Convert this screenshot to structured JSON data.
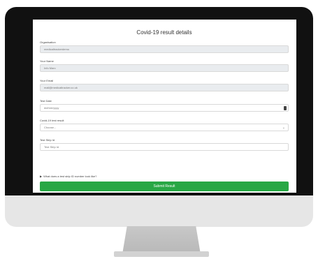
{
  "form": {
    "title": "Covid-19 result details",
    "fields": [
      {
        "label": "Organisation",
        "value": "medicaltrackerdemo"
      },
      {
        "label": "Your Name",
        "value": "Info Marc"
      },
      {
        "label": "Your Email",
        "value": "mail@medicaltracker.co.uk"
      },
      {
        "label": "Test Date",
        "placeholder": "dd/mm/yyyy"
      },
      {
        "label": "Covid-19 test result",
        "selected": "Choose..."
      },
      {
        "label": "Test Strip Id",
        "placeholder": "Test Strip Id"
      }
    ],
    "help_text": "What does a test strip ID number look like?",
    "submit_label": "Submit Result"
  }
}
